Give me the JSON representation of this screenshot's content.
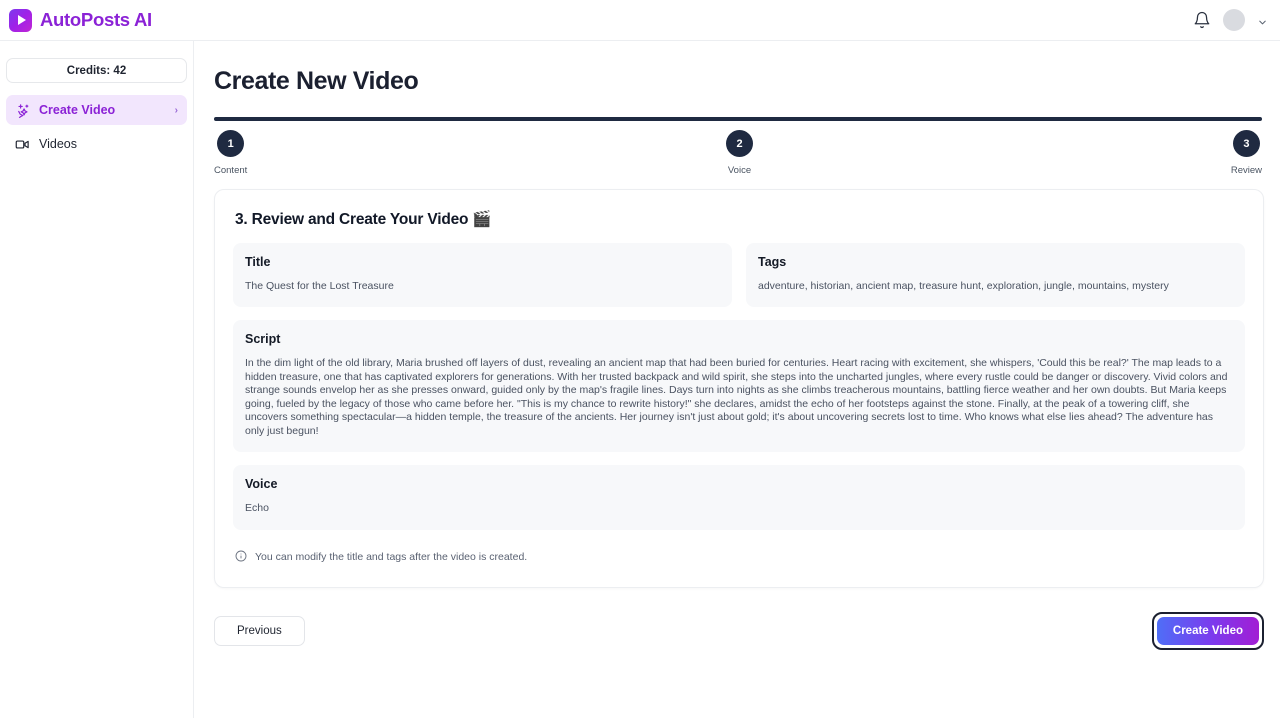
{
  "app": {
    "brand_name": "AutoPosts AI"
  },
  "sidebar": {
    "credits_label": "Credits: 42",
    "items": [
      {
        "label": "Create Video",
        "icon": "sparkles-icon",
        "active": true,
        "chevron": "›"
      },
      {
        "label": "Videos",
        "icon": "video-camera-icon",
        "active": false
      }
    ]
  },
  "header": {
    "page_title": "Create New Video"
  },
  "stepper": {
    "steps": [
      {
        "number": "1",
        "label": "Content"
      },
      {
        "number": "2",
        "label": "Voice"
      },
      {
        "number": "3",
        "label": "Review"
      }
    ],
    "bar_color": "#1f2a41"
  },
  "card": {
    "title": "3. Review and Create Your Video 🎬",
    "fields": {
      "title_label": "Title",
      "title_value": "The Quest for the Lost Treasure",
      "tags_label": "Tags",
      "tags_value": "adventure, historian, ancient map, treasure hunt, exploration, jungle, mountains, mystery",
      "script_label": "Script",
      "script_value": "In the dim light of the old library, Maria brushed off layers of dust, revealing an ancient map that had been buried for centuries. Heart racing with excitement, she whispers, 'Could this be real?' The map leads to a hidden treasure, one that has captivated explorers for generations. With her trusted backpack and wild spirit, she steps into the uncharted jungles, where every rustle could be danger or discovery. Vivid colors and strange sounds envelop her as she presses onward, guided only by the map's fragile lines. Days turn into nights as she climbs treacherous mountains, battling fierce weather and her own doubts. But Maria keeps going, fueled by the legacy of those who came before her. \"This is my chance to rewrite history!\" she declares, amidst the echo of her footsteps against the stone. Finally, at the peak of a towering cliff, she uncovers something spectacular—a hidden temple, the treasure of the ancients. Her journey isn't just about gold; it's about uncovering secrets lost to time. Who knows what else lies ahead? The adventure has only just begun!",
      "voice_label": "Voice",
      "voice_value": "Echo"
    },
    "note": "You can modify the title and tags after the video is created."
  },
  "footer": {
    "previous_label": "Previous",
    "create_label": "Create Video",
    "create_gradient_start": "#4f6ef7",
    "create_gradient_end": "#a21ed4"
  }
}
